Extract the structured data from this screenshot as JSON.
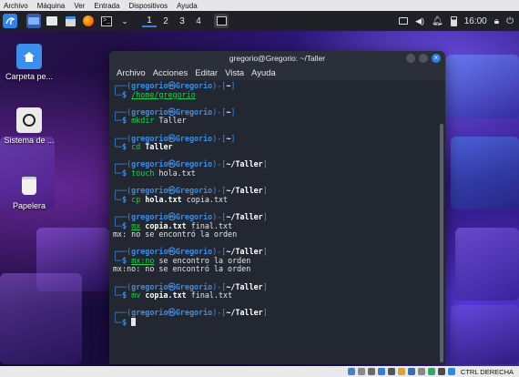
{
  "host_menu": [
    "Archivo",
    "Máquina",
    "Ver",
    "Entrada",
    "Dispositivos",
    "Ayuda"
  ],
  "panel": {
    "workspaces": [
      "1",
      "2",
      "3",
      "4"
    ],
    "clock": "16:00"
  },
  "desktop_icons": [
    {
      "label": "Carpeta pe...",
      "icon": "home-folder-icon"
    },
    {
      "label": "Sistema de ...",
      "icon": "filesystem-icon"
    },
    {
      "label": "Papelera",
      "icon": "trash-icon"
    }
  ],
  "terminal": {
    "title": "gregorio@Gregorio: ~/Taller",
    "menu": [
      "Archivo",
      "Acciones",
      "Editar",
      "Vista",
      "Ayuda"
    ],
    "prompt_user": "gregorio",
    "prompt_host": "Gregorio",
    "blocks": [
      {
        "path": "~",
        "cmd": "/home/gregorio",
        "args": "",
        "output": []
      },
      {
        "path": "~",
        "cmd": "mkdir",
        "args": " Taller",
        "output": []
      },
      {
        "path": "~",
        "cmd": "cd",
        "args": " Taller",
        "output": []
      },
      {
        "path": "~/Taller",
        "cmd": "touch",
        "args": " hola.txt",
        "output": []
      },
      {
        "path": "~/Taller",
        "cmd": "cp",
        "args": " hola.txt copia.txt",
        "output": []
      },
      {
        "path": "~/Taller",
        "cmd": "mx",
        "args": " copia.txt final.txt",
        "output": [
          "mx: no se encontró la orden"
        ]
      },
      {
        "path": "~/Taller",
        "cmd": "mx:no",
        "args": " se encontro la orden",
        "output": [
          "mx:no: no se encontró la orden"
        ]
      },
      {
        "path": "~/Taller",
        "cmd": "mv",
        "args": " copia.txt final.txt",
        "output": []
      },
      {
        "path": "~/Taller",
        "cmd": "",
        "args": "",
        "output": []
      }
    ]
  },
  "statusbar": {
    "host_key": "CTRL DERECHA"
  }
}
